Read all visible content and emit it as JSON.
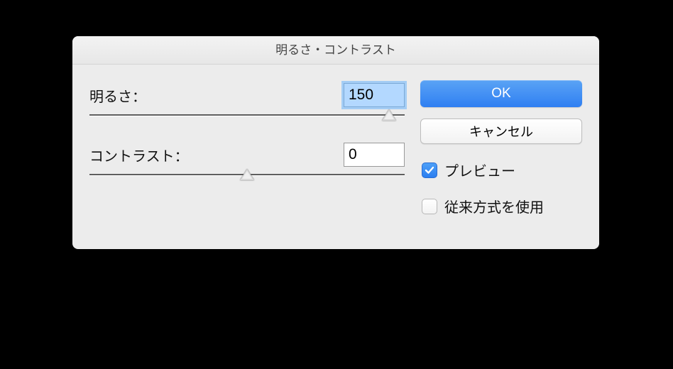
{
  "dialog": {
    "title": "明るさ・コントラスト",
    "brightness": {
      "label": "明るさ：",
      "value": "150",
      "slider_pos_pct": 95
    },
    "contrast": {
      "label": "コントラスト：",
      "value": "0",
      "slider_pos_pct": 50
    },
    "ok_label": "OK",
    "cancel_label": "キャンセル",
    "preview": {
      "label": "プレビュー",
      "checked": true
    },
    "legacy": {
      "label": "従来方式を使用",
      "checked": false
    }
  }
}
